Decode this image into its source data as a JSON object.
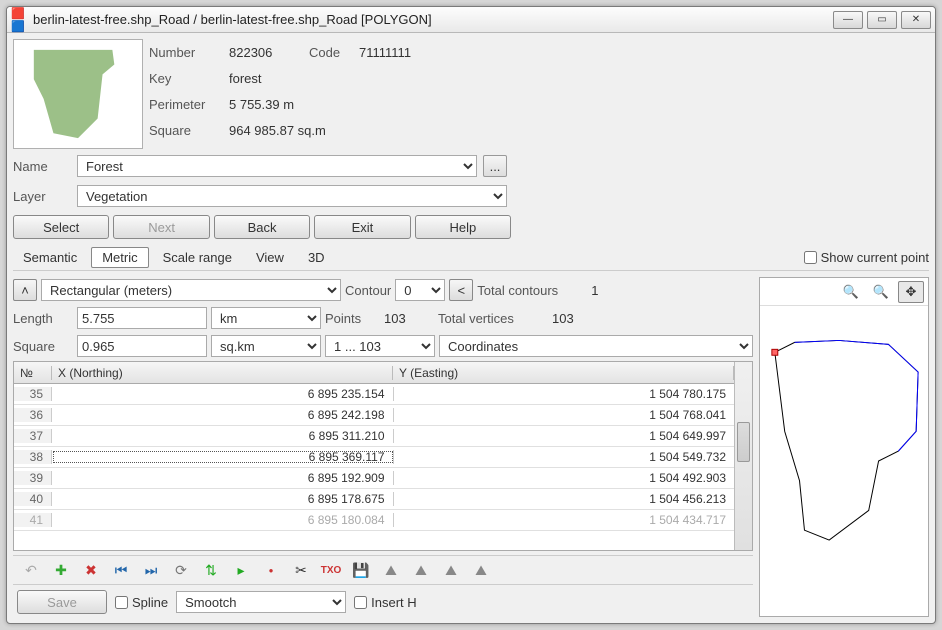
{
  "window": {
    "title": "berlin-latest-free.shp_Road / berlin-latest-free.shp_Road [POLYGON]"
  },
  "props": {
    "number_label": "Number",
    "number": "822306",
    "code_label": "Code",
    "code": "71111111",
    "key_label": "Key",
    "key": "forest",
    "perimeter_label": "Perimeter",
    "perimeter": "5 755.39 m",
    "square_label": "Square",
    "square": "964 985.87 sq.m"
  },
  "form": {
    "name_label": "Name",
    "name": "Forest",
    "layer_label": "Layer",
    "layer": "Vegetation"
  },
  "buttons": {
    "select": "Select",
    "next": "Next",
    "back": "Back",
    "exit": "Exit",
    "help": "Help"
  },
  "tabs": {
    "semantic": "Semantic",
    "metric": "Metric",
    "scale": "Scale range",
    "view": "View",
    "threed": "3D",
    "show_current": "Show current point"
  },
  "metric": {
    "coord_system": "Rectangular (meters)",
    "contour_label": "Contour",
    "contour": "0",
    "total_contours_label": "Total contours",
    "total_contours": "1",
    "length_label": "Length",
    "length": "5.755",
    "length_unit": "km",
    "points_label": "Points",
    "points": "103",
    "total_vertices_label": "Total vertices",
    "total_vertices": "103",
    "square_label": "Square",
    "square": "0.965",
    "square_unit": "sq.km",
    "range": "1 ... 103",
    "coords": "Coordinates"
  },
  "table": {
    "col_num": "№",
    "col_x": "X (Northing)",
    "col_y": "Y (Easting)",
    "rows": [
      {
        "n": "35",
        "x": "6 895 235.154",
        "y": "1 504 780.175"
      },
      {
        "n": "36",
        "x": "6 895 242.198",
        "y": "1 504 768.041"
      },
      {
        "n": "37",
        "x": "6 895 311.210",
        "y": "1 504 649.997"
      },
      {
        "n": "38",
        "x": "6 895 369.117",
        "y": "1 504 549.732",
        "selected": true
      },
      {
        "n": "39",
        "x": "6 895 192.909",
        "y": "1 504 492.903"
      },
      {
        "n": "40",
        "x": "6 895 178.675",
        "y": "1 504 456.213"
      },
      {
        "n": "41",
        "x": "6 895 180.084",
        "y": "1 504 434.717",
        "faded": true
      }
    ]
  },
  "bottom": {
    "save": "Save",
    "spline": "Spline",
    "smooth": "Smootch",
    "insert_h": "Insert H"
  },
  "icons": {
    "undo": "↶",
    "add": "✚",
    "del": "✖",
    "first": "⏮",
    "last": "⏭",
    "reload": "⟳",
    "sync": "⇅",
    "play": "▸",
    "rec": "●",
    "cut": "✂",
    "txo": "TXO",
    "save": "💾",
    "lvl1": "⛰",
    "lvl2": "⛰",
    "lvl3": "⛰",
    "lvl4": "⛰"
  }
}
